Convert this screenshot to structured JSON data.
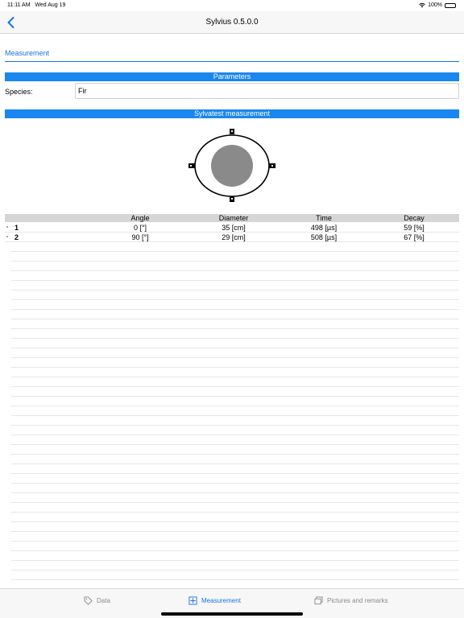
{
  "status_bar": {
    "time": "11:11 AM",
    "date": "Wed Aug 19",
    "battery": "100%"
  },
  "nav": {
    "title": "Sylvius 0.5.0.0"
  },
  "section": {
    "tab_label": "Measurement"
  },
  "parameters": {
    "banner": "Parameters",
    "species_label": "Species:",
    "species_value": "Fir"
  },
  "sylvatest": {
    "banner": "Sylvatest measurement"
  },
  "table": {
    "headers": {
      "angle": "Angle",
      "diameter": "Diameter",
      "time": "Time",
      "decay": "Decay"
    },
    "rows": [
      {
        "num": "1",
        "angle": "0 [°]",
        "diameter": "35 [cm]",
        "time": "498 [µs]",
        "decay": "59 [%]"
      },
      {
        "num": "2",
        "angle": "90 [°]",
        "diameter": "29 [cm]",
        "time": "508 [µs]",
        "decay": "67 [%]"
      }
    ]
  },
  "tabbar": {
    "data": "Data",
    "measurement": "Measurement",
    "pictures": "Pictures and remarks"
  },
  "colors": {
    "accent": "#1a73e8",
    "banner": "#1a86f0",
    "core": "#8a8a8a"
  }
}
